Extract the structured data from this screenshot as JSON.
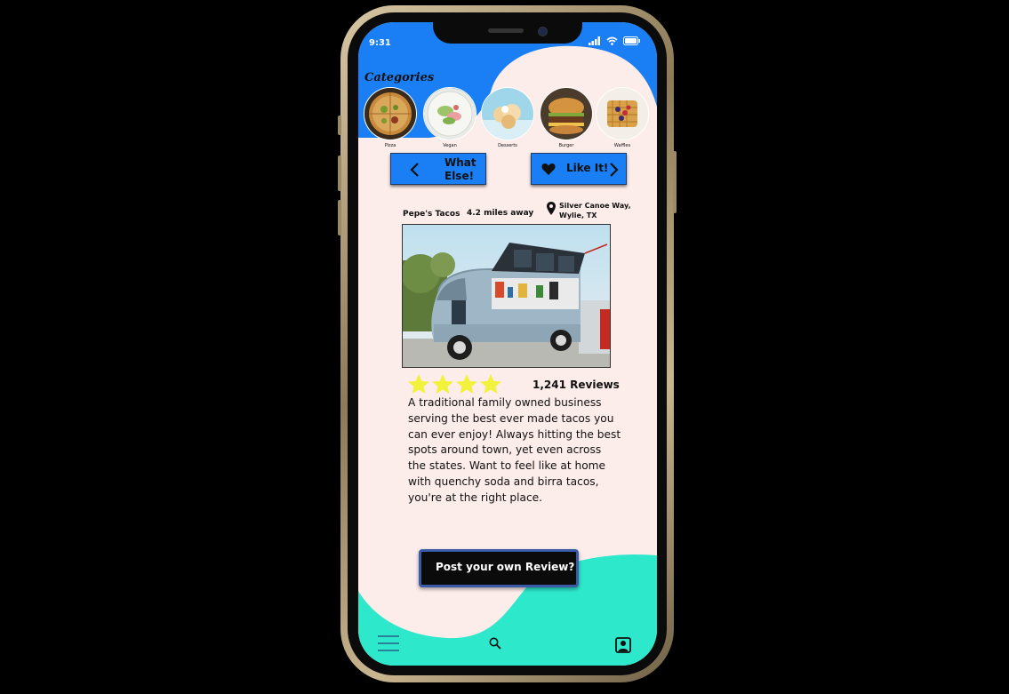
{
  "status_bar": {
    "time": "9:31"
  },
  "categories": {
    "title": "Categories",
    "items": [
      {
        "label": "Pizza",
        "icon": "pizza-image"
      },
      {
        "label": "Vegan",
        "icon": "vegan-image"
      },
      {
        "label": "Desserts",
        "icon": "desserts-image"
      },
      {
        "label": "Burger",
        "icon": "burger-image"
      },
      {
        "label": "Waffles",
        "icon": "waffles-image"
      }
    ]
  },
  "actions": {
    "prev_label_line1": "What",
    "prev_label_line2": "Else!",
    "like_label": "Like It!"
  },
  "listing": {
    "name": "Pepe's Tacos",
    "distance": "4.2 miles away",
    "address_line1": "Silver Canoe Way,",
    "address_line2": "Wylie, TX",
    "rating": 4,
    "rating_max": 4,
    "reviews": "1,241 Reviews",
    "description_lines": [
      "A traditional family owned business",
      "serving the best ever made tacos you",
      "can ever enjoy! Always hitting the best",
      "spots around town, yet even across",
      "the states. Want to feel like at home",
      "with quenchy soda and birra tacos,",
      "you're at the right place."
    ]
  },
  "post_review_label": "Post your own Review?",
  "tab_bar": {
    "items": [
      "menu-icon",
      "search-icon",
      "profile-icon"
    ]
  },
  "colors": {
    "blue": "#1a7ff5",
    "teal": "#2ee8cc",
    "background": "#fcecea",
    "star": "#f2f23c"
  }
}
